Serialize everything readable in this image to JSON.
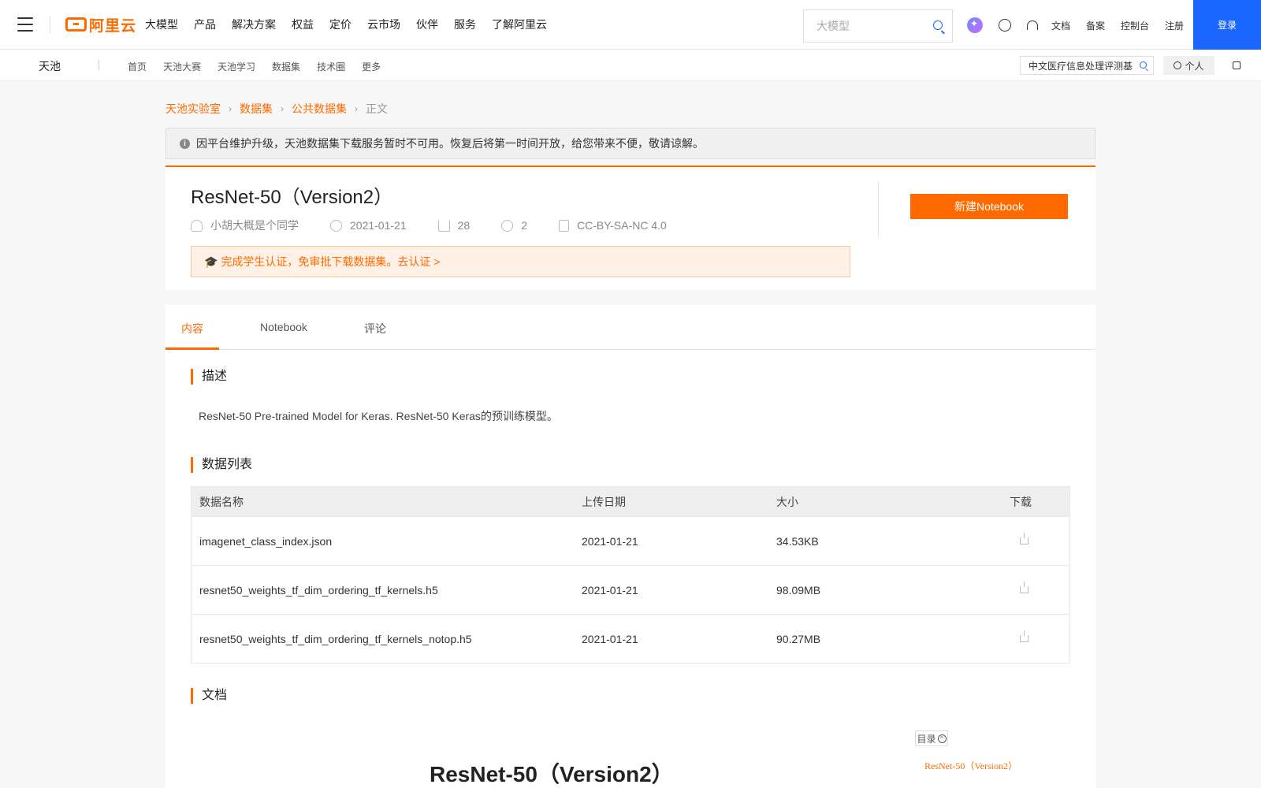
{
  "topnav": {
    "logo_text": "阿里云",
    "items": [
      "大模型",
      "产品",
      "解决方案",
      "权益",
      "定价",
      "云市场",
      "伙伴",
      "服务",
      "了解阿里云"
    ],
    "search_placeholder": "大模型",
    "links": [
      "文档",
      "备案",
      "控制台",
      "注册"
    ],
    "login": "登录",
    "accent": "#1a66ff"
  },
  "subnav": {
    "brand": "天池",
    "links": [
      "首页",
      "天池大赛",
      "天池学习",
      "数据集",
      "技术圈",
      "更多"
    ],
    "search_value": "中文医疗信息处理评测基",
    "personal": "个人"
  },
  "breadcrumb": [
    "天池实验室",
    "数据集",
    "公共数据集",
    "正文"
  ],
  "notice": "因平台维护升级，天池数据集下载服务暂时不可用。恢复后将第一时间开放，给您带来不便，敬请谅解。",
  "dataset": {
    "title": "ResNet-50（Version2）",
    "author": "小胡大概是个同学",
    "date": "2021-01-21",
    "downloads": "28",
    "shares": "2",
    "license": "CC-BY-SA-NC 4.0",
    "student_banner": "完成学生认证，免审批下载数据集。去认证 >",
    "new_notebook": "新建Notebook",
    "accent": "#ff6a00"
  },
  "tabs": [
    "内容",
    "Notebook",
    "评论"
  ],
  "sections": {
    "description_title": "描述",
    "description": "ResNet-50 Pre-trained Model for Keras. ResNet-50 Keras的预训练模型。",
    "data_list_title": "数据列表",
    "docs_title": "文档"
  },
  "table": {
    "headers": [
      "数据名称",
      "上传日期",
      "大小",
      "下载"
    ],
    "rows": [
      {
        "name": "imagenet_class_index.json",
        "date": "2021-01-21",
        "size": "34.53KB"
      },
      {
        "name": "resnet50_weights_tf_dim_ordering_tf_kernels.h5",
        "date": "2021-01-21",
        "size": "98.09MB"
      },
      {
        "name": "resnet50_weights_tf_dim_ordering_tf_kernels_notop.h5",
        "date": "2021-01-21",
        "size": "90.27MB"
      }
    ]
  },
  "toc": {
    "label": "目录",
    "item": "ResNet-50（Version2）"
  },
  "doc_heading": "ResNet-50（Version2）"
}
